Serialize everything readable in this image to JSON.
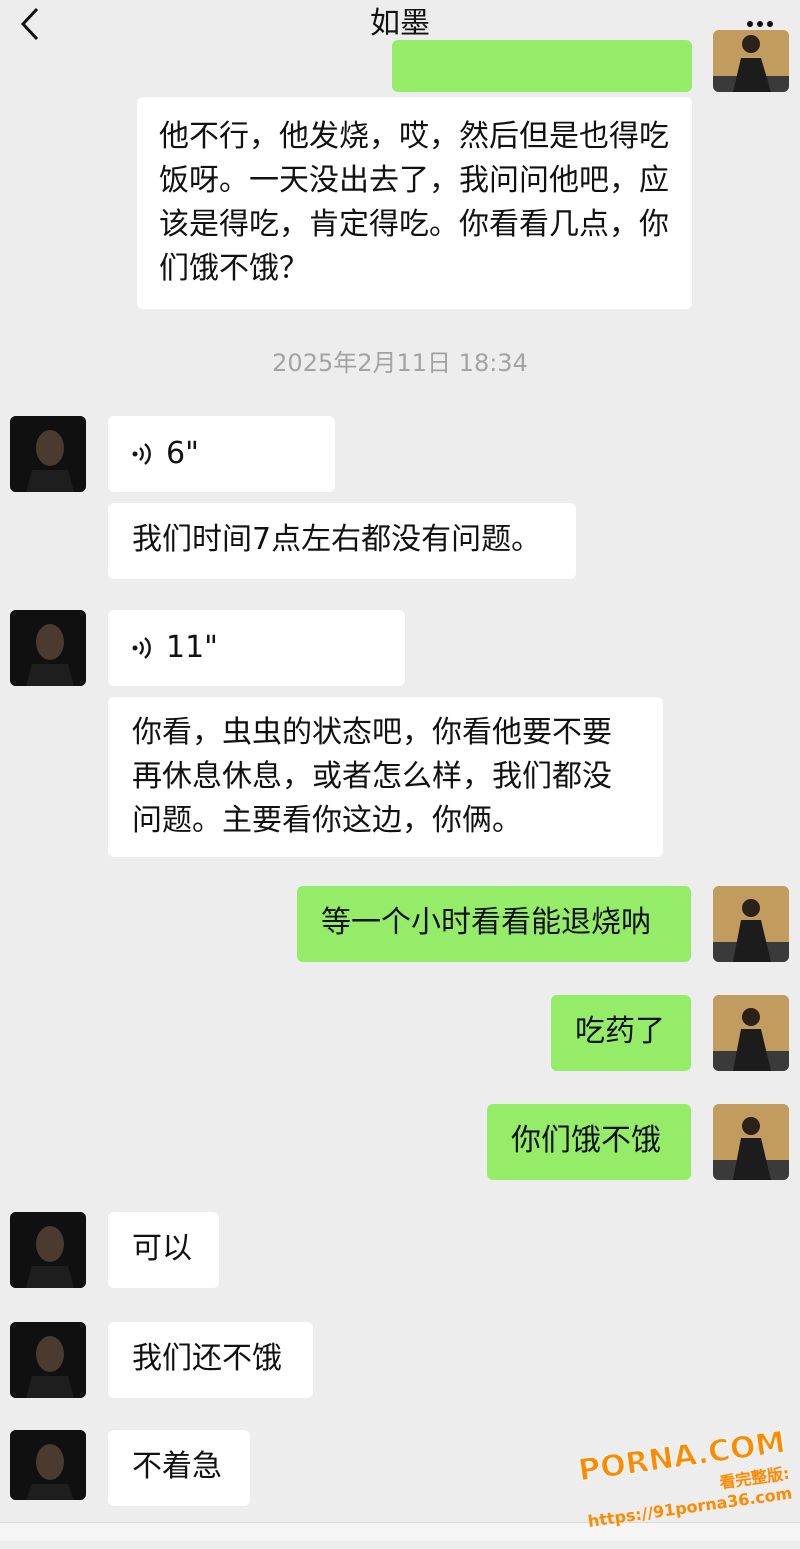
{
  "header": {
    "title": "如墨"
  },
  "messages": {
    "m0": "他不行，他发烧，哎，然后但是也得吃饭呀。一天没出去了，我问问他吧，应该是得吃，肯定得吃。你看看几点，你们饿不饿？",
    "timestamp": "2025年2月11日 18:34",
    "voice1": "6\"",
    "m1": "我们时间7点左右都没有问题。",
    "voice2": "11\"",
    "m2": "你看，虫虫的状态吧，你看他要不要再休息休息，或者怎么样，我们都没问题。主要看你这边，你俩。",
    "m3": "等一个小时看看能退烧呐",
    "m4": "吃药了",
    "m5": "你们饿不饿",
    "m6": "可以",
    "m7": "我们还不饿",
    "m8": "不着急"
  },
  "watermark": {
    "brand": "PORNA.COM",
    "url": "看完整版: https://91porna36.com"
  },
  "colors": {
    "background": "#ededed",
    "self_bubble": "#95ec69",
    "other_bubble": "#ffffff"
  }
}
